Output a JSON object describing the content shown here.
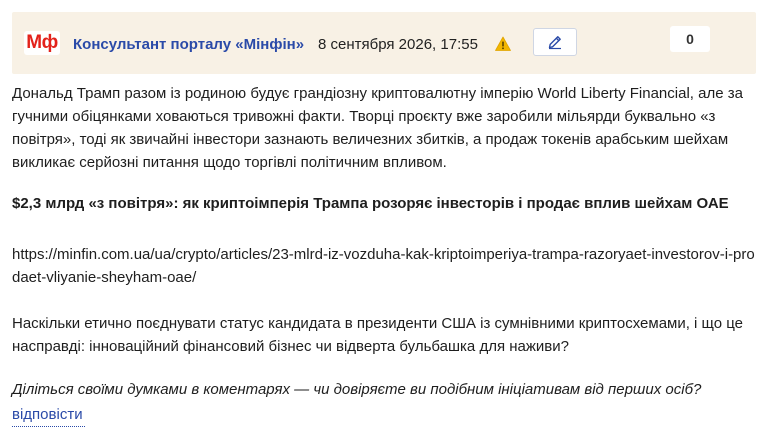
{
  "header": {
    "logo_text": "Мф",
    "author": "Консультант порталу «Мінфін»",
    "date": "8 сентября 2026, 17:55",
    "counter": "0",
    "icons": {
      "warning": "warning-icon",
      "edit": "pencil-icon"
    },
    "colors": {
      "header_bg": "#f8f1e5",
      "logo_red": "#e3221b",
      "author_blue": "#2a4aa8",
      "warning_yellow": "#f2b600"
    }
  },
  "body": {
    "paragraph_1": "Дональд Трамп разом із родиною будує грандіозну криптовалютну імперію World Liberty Financial, але за гучними обіцянками ховаються тривожні факти. Творці проєкту вже заробили мільярди буквально «з повітря», тоді як звичайні інвестори зазнають величезних збитків, а продаж токенів арабським шейхам викликає серйозні питання щодо торгівлі політичним впливом.",
    "headline": "$2,3 млрд «з повітря»: як криптоімперія Трампа розоряє інвесторів і продає вплив шейхам ОАЕ",
    "url": "https://minfin.com.ua/ua/crypto/articles/23-mlrd-iz-vozduha-kak-kriptoimperiya-trampa-razoryaet-investorov-i-prodaet-vliyanie-sheyham-oae/",
    "paragraph_3": "Наскільки етично поєднувати статус кандидата в президенти США із сумнівними криптосхемами, і що це насправді: інноваційний фінансовий бізнес чи відверта бульбашка для наживи?",
    "closing_question": "Діліться своїми думками в коментарях — чи довіряєте ви подібним ініціативам від перших осіб?"
  },
  "footer": {
    "reply_label": "відповісти"
  }
}
